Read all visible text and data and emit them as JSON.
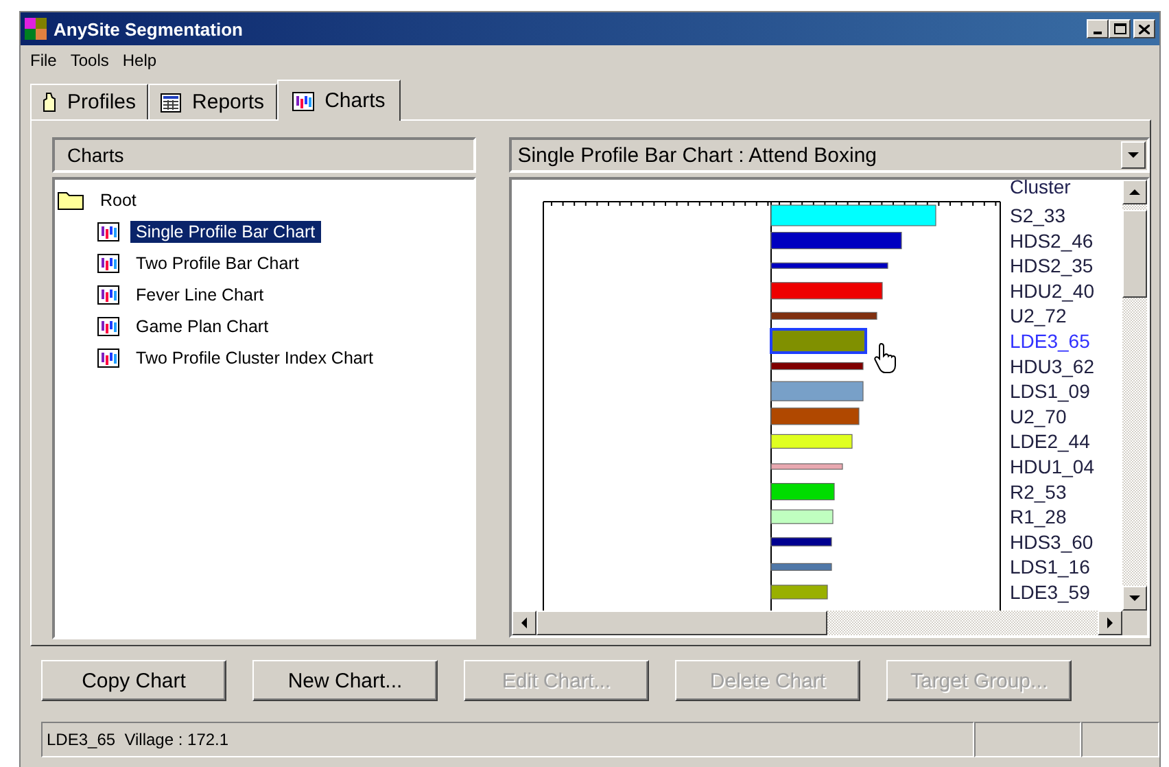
{
  "window": {
    "title": "AnySite Segmentation"
  },
  "menu": [
    "File",
    "Tools",
    "Help"
  ],
  "tabs": [
    {
      "label": "Profiles",
      "selected": false
    },
    {
      "label": "Reports",
      "selected": false
    },
    {
      "label": "Charts",
      "selected": true
    }
  ],
  "charts_panel": {
    "header": "Charts",
    "tree": {
      "label": "Root",
      "children": [
        {
          "label": "Single Profile Bar Chart",
          "selected": true
        },
        {
          "label": "Two Profile Bar Chart",
          "selected": false
        },
        {
          "label": "Fever Line Chart",
          "selected": false
        },
        {
          "label": "Game Plan Chart",
          "selected": false
        },
        {
          "label": "Two Profile Cluster Index Chart",
          "selected": false
        }
      ]
    }
  },
  "chart_view": {
    "dropdown": "Single Profile Bar Chart : Attend Boxing",
    "column_header": "Cluster",
    "clusters": [
      {
        "label": "S2_33",
        "color": "#00ffff",
        "selected": false
      },
      {
        "label": "HDS2_46",
        "color": "#0000c0",
        "selected": false
      },
      {
        "label": "HDS2_35",
        "color": "#0000c0",
        "selected": false
      },
      {
        "label": "HDU2_40",
        "color": "#ee0000",
        "selected": false
      },
      {
        "label": "U2_72",
        "color": "#803010",
        "selected": false
      },
      {
        "label": "LDE3_65",
        "color": "#809000",
        "selected": true
      },
      {
        "label": "HDU3_62",
        "color": "#800000",
        "selected": false
      },
      {
        "label": "LDS1_09",
        "color": "#78a0c8",
        "selected": false
      },
      {
        "label": "U2_70",
        "color": "#b04800",
        "selected": false
      },
      {
        "label": "LDE2_44",
        "color": "#e0ff20",
        "selected": false
      },
      {
        "label": "HDU1_04",
        "color": "#e8a8b0",
        "selected": false
      },
      {
        "label": "R2_53",
        "color": "#00dd00",
        "selected": false
      },
      {
        "label": "R1_28",
        "color": "#c0ffc0",
        "selected": false
      },
      {
        "label": "HDS3_60",
        "color": "#000090",
        "selected": false
      },
      {
        "label": "LDS1_16",
        "color": "#5078a8",
        "selected": false
      },
      {
        "label": "LDE3_59",
        "color": "#99b000",
        "selected": false
      }
    ]
  },
  "buttons": [
    {
      "label": "Copy Chart",
      "disabled": false
    },
    {
      "label": "New Chart...",
      "disabled": false
    },
    {
      "label": "Edit Chart...",
      "disabled": true
    },
    {
      "label": "Delete Chart",
      "disabled": true
    },
    {
      "label": "Target Group...",
      "disabled": true
    }
  ],
  "status_bar": {
    "text": "LDE3_65  Village : 172.1"
  }
}
